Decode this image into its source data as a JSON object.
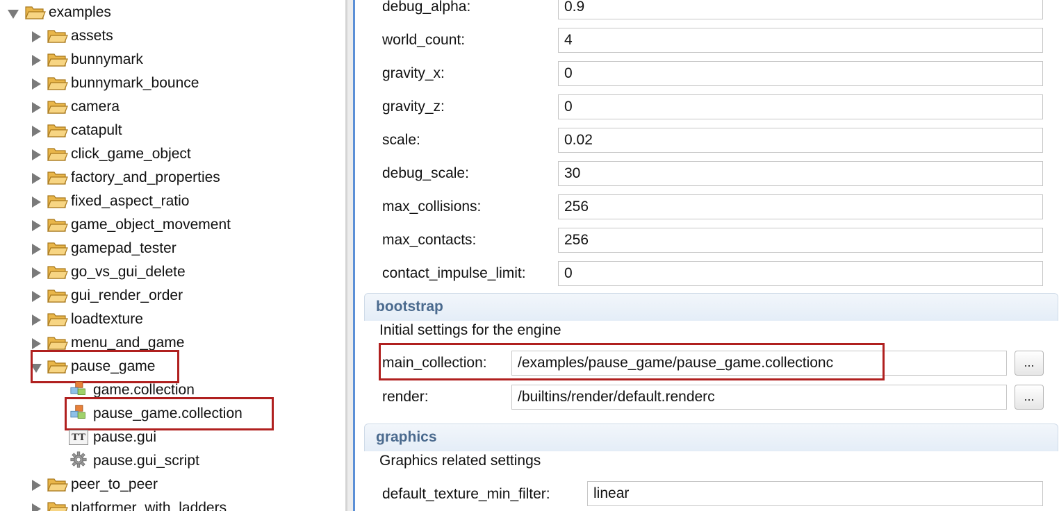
{
  "tree": {
    "root": "examples",
    "folders_top": [
      "assets",
      "bunnymark",
      "bunnymark_bounce",
      "camera",
      "catapult",
      "click_game_object",
      "factory_and_properties",
      "fixed_aspect_ratio",
      "game_object_movement",
      "gamepad_tester",
      "go_vs_gui_delete",
      "gui_render_order",
      "loadtexture",
      "menu_and_game"
    ],
    "expanded_folder": "pause_game",
    "children": [
      {
        "name": "game.collection",
        "icon": "collection-icon"
      },
      {
        "name": "pause_game.collection",
        "icon": "collection-icon"
      },
      {
        "name": "pause.gui",
        "icon": "gui-icon"
      },
      {
        "name": "pause.gui_script",
        "icon": "gear-icon"
      }
    ],
    "folders_bottom": [
      "peer_to_peer",
      "platformer_with_ladders"
    ],
    "gui_icon_text": "TT"
  },
  "physics_props": [
    {
      "label": "debug_alpha:",
      "value": "0.9"
    },
    {
      "label": "world_count:",
      "value": "4"
    },
    {
      "label": "gravity_x:",
      "value": "0"
    },
    {
      "label": "gravity_z:",
      "value": "0"
    },
    {
      "label": "scale:",
      "value": "0.02"
    },
    {
      "label": "debug_scale:",
      "value": "30"
    },
    {
      "label": "max_collisions:",
      "value": "256"
    },
    {
      "label": "max_contacts:",
      "value": "256"
    },
    {
      "label": "contact_impulse_limit:",
      "value": "0"
    }
  ],
  "bootstrap": {
    "title": "bootstrap",
    "description": "Initial settings for the engine",
    "main_collection_label": "main_collection:",
    "main_collection_value": "/examples/pause_game/pause_game.collectionc",
    "render_label": "render:",
    "render_value": "/builtins/render/default.renderc",
    "browse_label": "..."
  },
  "graphics": {
    "title": "graphics",
    "description": "Graphics related settings",
    "filter_label": "default_texture_min_filter:",
    "filter_value": "linear"
  },
  "colors": {
    "highlight": "#b0201f",
    "section_title": "#4a6a8e",
    "splitter_accent": "#5b8fd6"
  }
}
